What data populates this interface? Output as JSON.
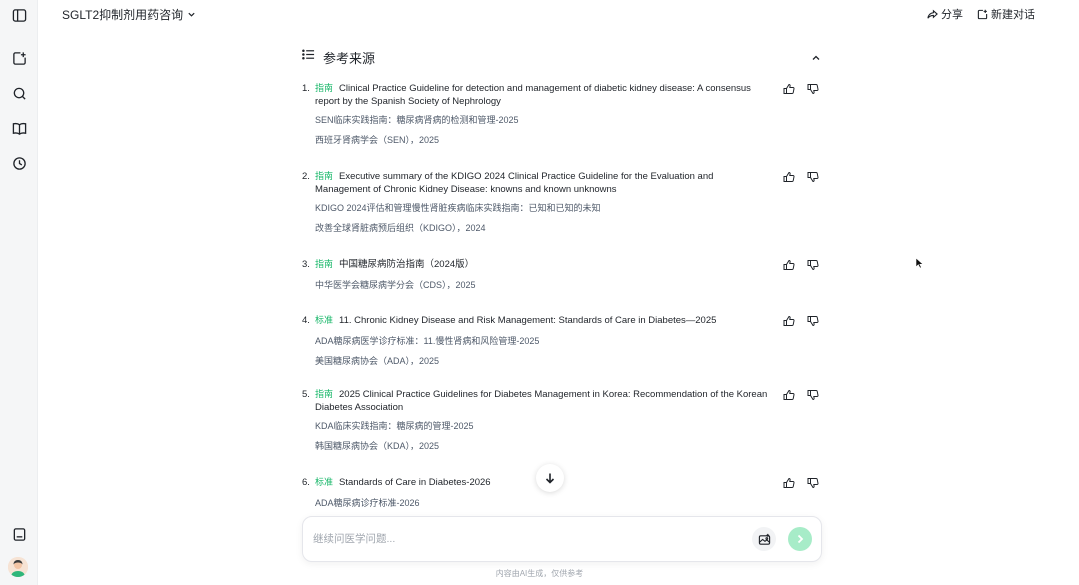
{
  "header": {
    "conversation_title": "SGLT2抑制剂用药咨询",
    "share_label": "分享",
    "new_chat_label": "新建对话"
  },
  "sidebar": {
    "icons": [
      "panel-toggle-icon",
      "new-chat-icon",
      "search-icon",
      "library-icon",
      "history-icon",
      "notebook-icon"
    ]
  },
  "references": {
    "title": "参考来源",
    "items": [
      {
        "num": "1.",
        "tag": "指南",
        "title": "Clinical Practice Guideline for detection and management of diabetic kidney disease: A consensus report by the Spanish Society of Nephrology",
        "subtitle": "SEN临床实践指南：糖尿病肾病的检测和管理-2025",
        "org": "西班牙肾病学会（SEN），2025"
      },
      {
        "num": "2.",
        "tag": "指南",
        "title": "Executive summary of the KDIGO 2024 Clinical Practice Guideline for the Evaluation and Management of Chronic Kidney Disease: knowns and known unknowns",
        "subtitle": "KDIGO 2024评估和管理慢性肾脏疾病临床实践指南：已知和已知的未知",
        "org": "改善全球肾脏病预后组织（KDIGO），2024"
      },
      {
        "num": "3.",
        "tag": "指南",
        "title": "中国糖尿病防治指南（2024版）",
        "subtitle": "",
        "org": "中华医学会糖尿病学分会（CDS），2025"
      },
      {
        "num": "4.",
        "tag": "标准",
        "title": "11. Chronic Kidney Disease and Risk Management: Standards of Care in Diabetes—2025",
        "subtitle": "ADA糖尿病医学诊疗标准：11.慢性肾病和风险管理-2025",
        "org": "美国糖尿病协会（ADA），2025"
      },
      {
        "num": "5.",
        "tag": "指南",
        "title": "2025 Clinical Practice Guidelines for Diabetes Management in Korea: Recommendation of the Korean Diabetes Association",
        "subtitle": "KDA临床实践指南：糖尿病的管理-2025",
        "org": "韩国糖尿病协会（KDA），2025"
      },
      {
        "num": "6.",
        "tag": "标准",
        "title": "Standards of Care in Diabetes-2026",
        "subtitle": "ADA糖尿病诊疗标准-2026",
        "org": ""
      }
    ]
  },
  "input": {
    "placeholder": "继续问医学问题..."
  },
  "footer": {
    "disclaimer": "内容由AI生成，仅供参考"
  },
  "colors": {
    "accent": "#19b76a",
    "send_button": "#a7ecc8",
    "sidebar_bg": "#f5f6f7"
  }
}
